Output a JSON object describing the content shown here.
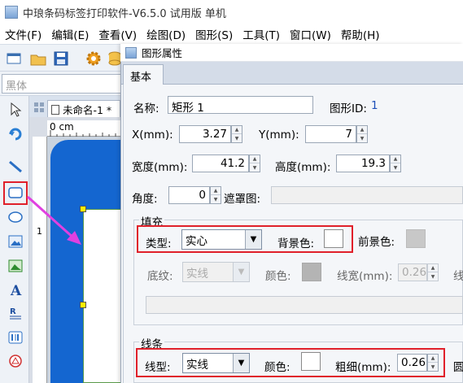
{
  "app": {
    "title": "中琅条码标签打印软件-V6.5.0 试用版 单机"
  },
  "menu": [
    "文件(F)",
    "编辑(E)",
    "查看(V)",
    "绘图(D)",
    "图形(S)",
    "工具(T)",
    "窗口(W)",
    "帮助(H)"
  ],
  "font_box": {
    "value": "黑体"
  },
  "document": {
    "tab_label": "未命名-1 *",
    "ruler_unit": "0 cm",
    "ruler_left_mark": "1"
  },
  "dialog": {
    "title": "图形属性",
    "tab": "基本",
    "name_label": "名称:",
    "name_value": "矩形 1",
    "id_label": "图形ID:",
    "id_value": "1",
    "x_label": "X(mm):",
    "x_value": "3.27",
    "y_label": "Y(mm):",
    "y_value": "7",
    "width_label": "宽度(mm):",
    "width_value": "41.2",
    "height_label": "高度(mm):",
    "height_value": "19.3",
    "angle_label": "角度:",
    "angle_value": "0",
    "mask_label": "遮罩图:",
    "fill": {
      "group_label": "填充",
      "type_label": "类型:",
      "type_value": "实心",
      "bg_label": "背景色:",
      "bg_color": "#ffffff",
      "fg_label": "前景色:",
      "fg_color": "#c8c8c8",
      "texture_label": "底纹:",
      "texture_value": "实线",
      "color_label": "颜色:",
      "color_value": "#b4b4b4",
      "linewidth_label": "线宽(mm):",
      "linewidth_value": "0.26",
      "clipped_label": "线"
    },
    "line": {
      "group_label": "线条",
      "type_label": "线型:",
      "type_value": "实线",
      "color_label": "颜色:",
      "color_value": "#ffffff",
      "thickness_label": "粗细(mm):",
      "thickness_value": "0.26",
      "clipped_label": "圆"
    }
  },
  "colors": {
    "highlight": "#e0202a",
    "arrow": "#e040e0",
    "shape_fill": "#1466d0"
  }
}
